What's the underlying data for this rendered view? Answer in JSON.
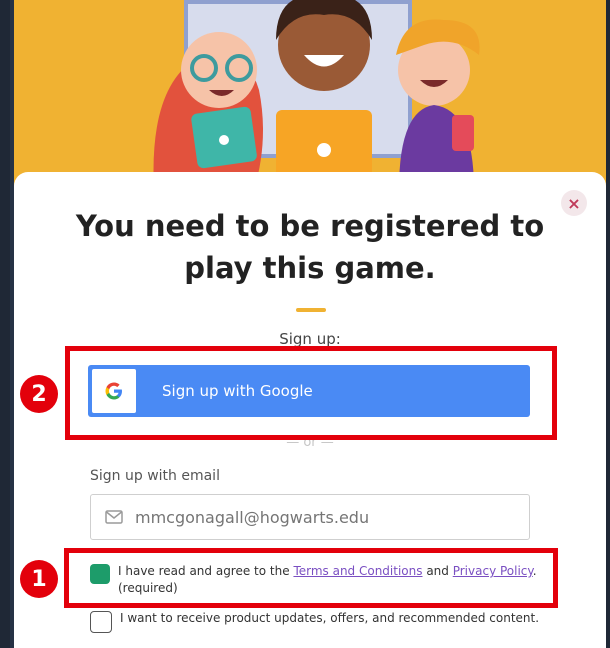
{
  "modal": {
    "title": "You need to be registered to play this game.",
    "close_symbol": "×",
    "signup_label": "Sign up:",
    "google_button": "Sign up with Google",
    "or_divider": "— or —",
    "email_label": "Sign up with email",
    "email_placeholder": "mmcgonagall@hogwarts.edu",
    "terms": {
      "prefix": "I have read and agree to the ",
      "terms_link": "Terms and Conditions",
      "middle": " and ",
      "privacy_link": "Privacy Policy",
      "suffix": ". (required)",
      "checked": true
    },
    "marketing": {
      "text": "I want to receive product updates, offers, and recommended content.",
      "checked": false
    }
  },
  "annotations": {
    "marker_1": "1",
    "marker_2": "2"
  },
  "colors": {
    "hero_bg": "#f0b232",
    "google_blue": "#4a8af4",
    "check_green": "#1d9c6a",
    "annotation_red": "#e3000b",
    "link_purple": "#7a4fc2"
  },
  "icons": {
    "google": "google-g-icon",
    "mail": "mail-icon",
    "close": "close-icon"
  }
}
